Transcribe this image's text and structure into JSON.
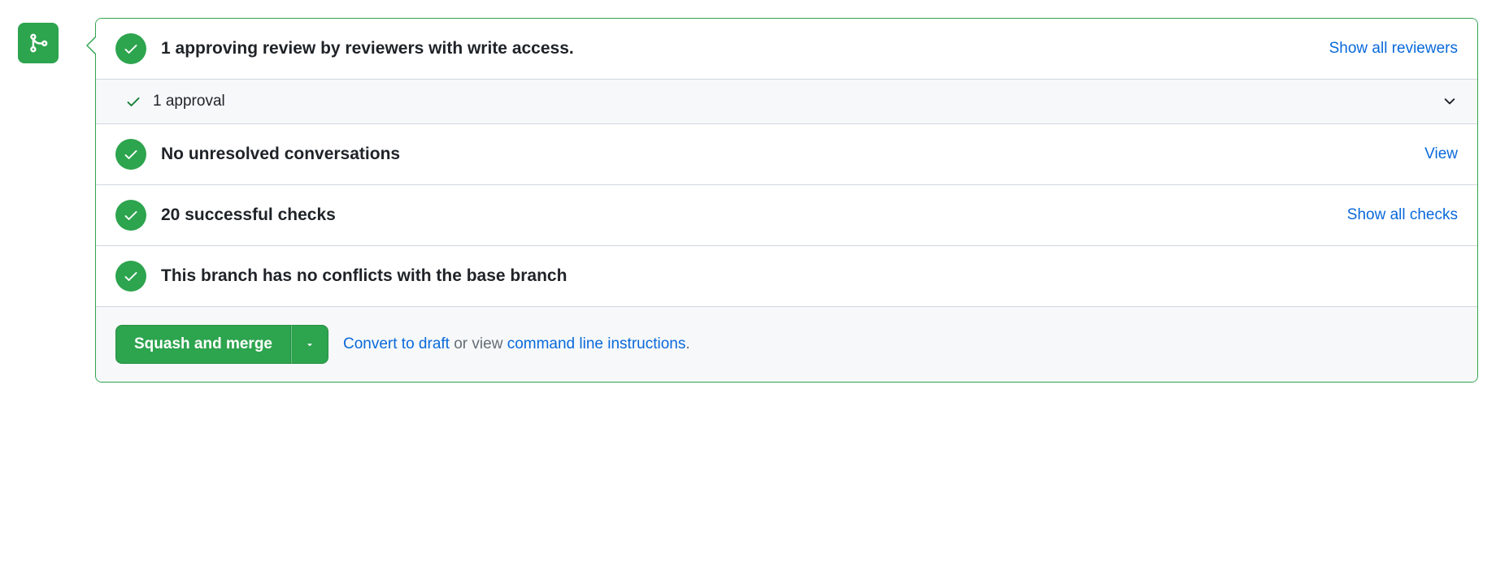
{
  "reviews": {
    "title": "1 approving review by reviewers with write access.",
    "show_all": "Show all reviewers",
    "approval_count": "1 approval"
  },
  "conversations": {
    "title": "No unresolved conversations",
    "view": "View"
  },
  "checks": {
    "title": "20 successful checks",
    "show_all": "Show all checks"
  },
  "conflicts": {
    "title": "This branch has no conflicts with the base branch"
  },
  "footer": {
    "merge_label": "Squash and merge",
    "convert_draft": "Convert to draft",
    "or_view": " or view ",
    "cli": "command line instructions",
    "period": "."
  }
}
